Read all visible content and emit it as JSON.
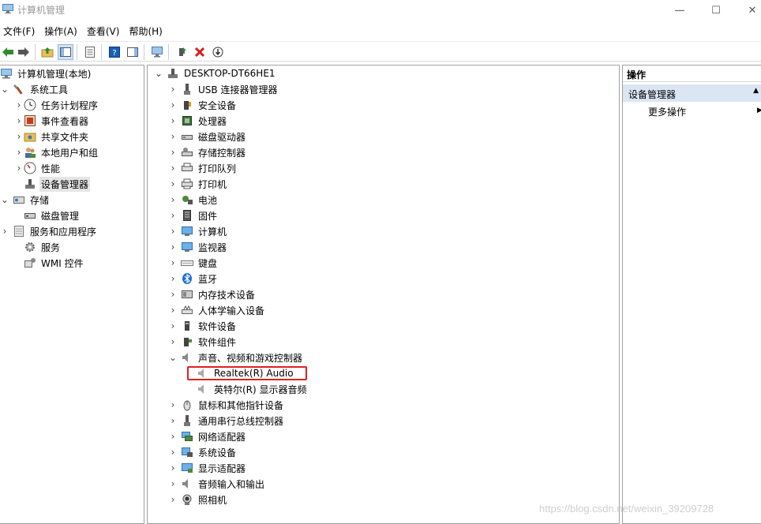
{
  "window": {
    "title": "计算机管理",
    "minimize": "—",
    "maximize": "☐",
    "close": "✕"
  },
  "menu": [
    "文件(F)",
    "操作(A)",
    "查看(V)",
    "帮助(H)"
  ],
  "left_tree": {
    "root": "计算机管理(本地)",
    "groups": [
      {
        "label": "系统工具",
        "children": [
          "任务计划程序",
          "事件查看器",
          "共享文件夹",
          "本地用户和组",
          "性能",
          "设备管理器"
        ]
      },
      {
        "label": "存储",
        "children": [
          "磁盘管理"
        ]
      },
      {
        "label": "服务和应用程序",
        "children": [
          "服务",
          "WMI 控件"
        ]
      }
    ]
  },
  "device_tree": {
    "root": "DESKTOP-DT66HE1",
    "categories": [
      "USB 连接器管理器",
      "安全设备",
      "处理器",
      "磁盘驱动器",
      "存储控制器",
      "打印队列",
      "打印机",
      "电池",
      "固件",
      "计算机",
      "监视器",
      "键盘",
      "蓝牙",
      "内存技术设备",
      "人体学输入设备",
      "软件设备",
      "软件组件",
      "声音、视频和游戏控制器"
    ],
    "expanded_children": [
      "Realtek(R) Audio",
      "英特尔(R) 显示器音频"
    ],
    "categories_after": [
      "鼠标和其他指针设备",
      "通用串行总线控制器",
      "网络适配器",
      "系统设备",
      "显示适配器",
      "音频输入和输出",
      "照相机"
    ]
  },
  "actions": {
    "header": "操作",
    "section": "设备管理器",
    "item": "更多操作"
  },
  "watermark": "https://blog.csdn.net/weixin_39209728",
  "colors": {
    "highlight": "#e02020",
    "selection": "#e5e5e5",
    "action_section": "#dbe6f4"
  }
}
